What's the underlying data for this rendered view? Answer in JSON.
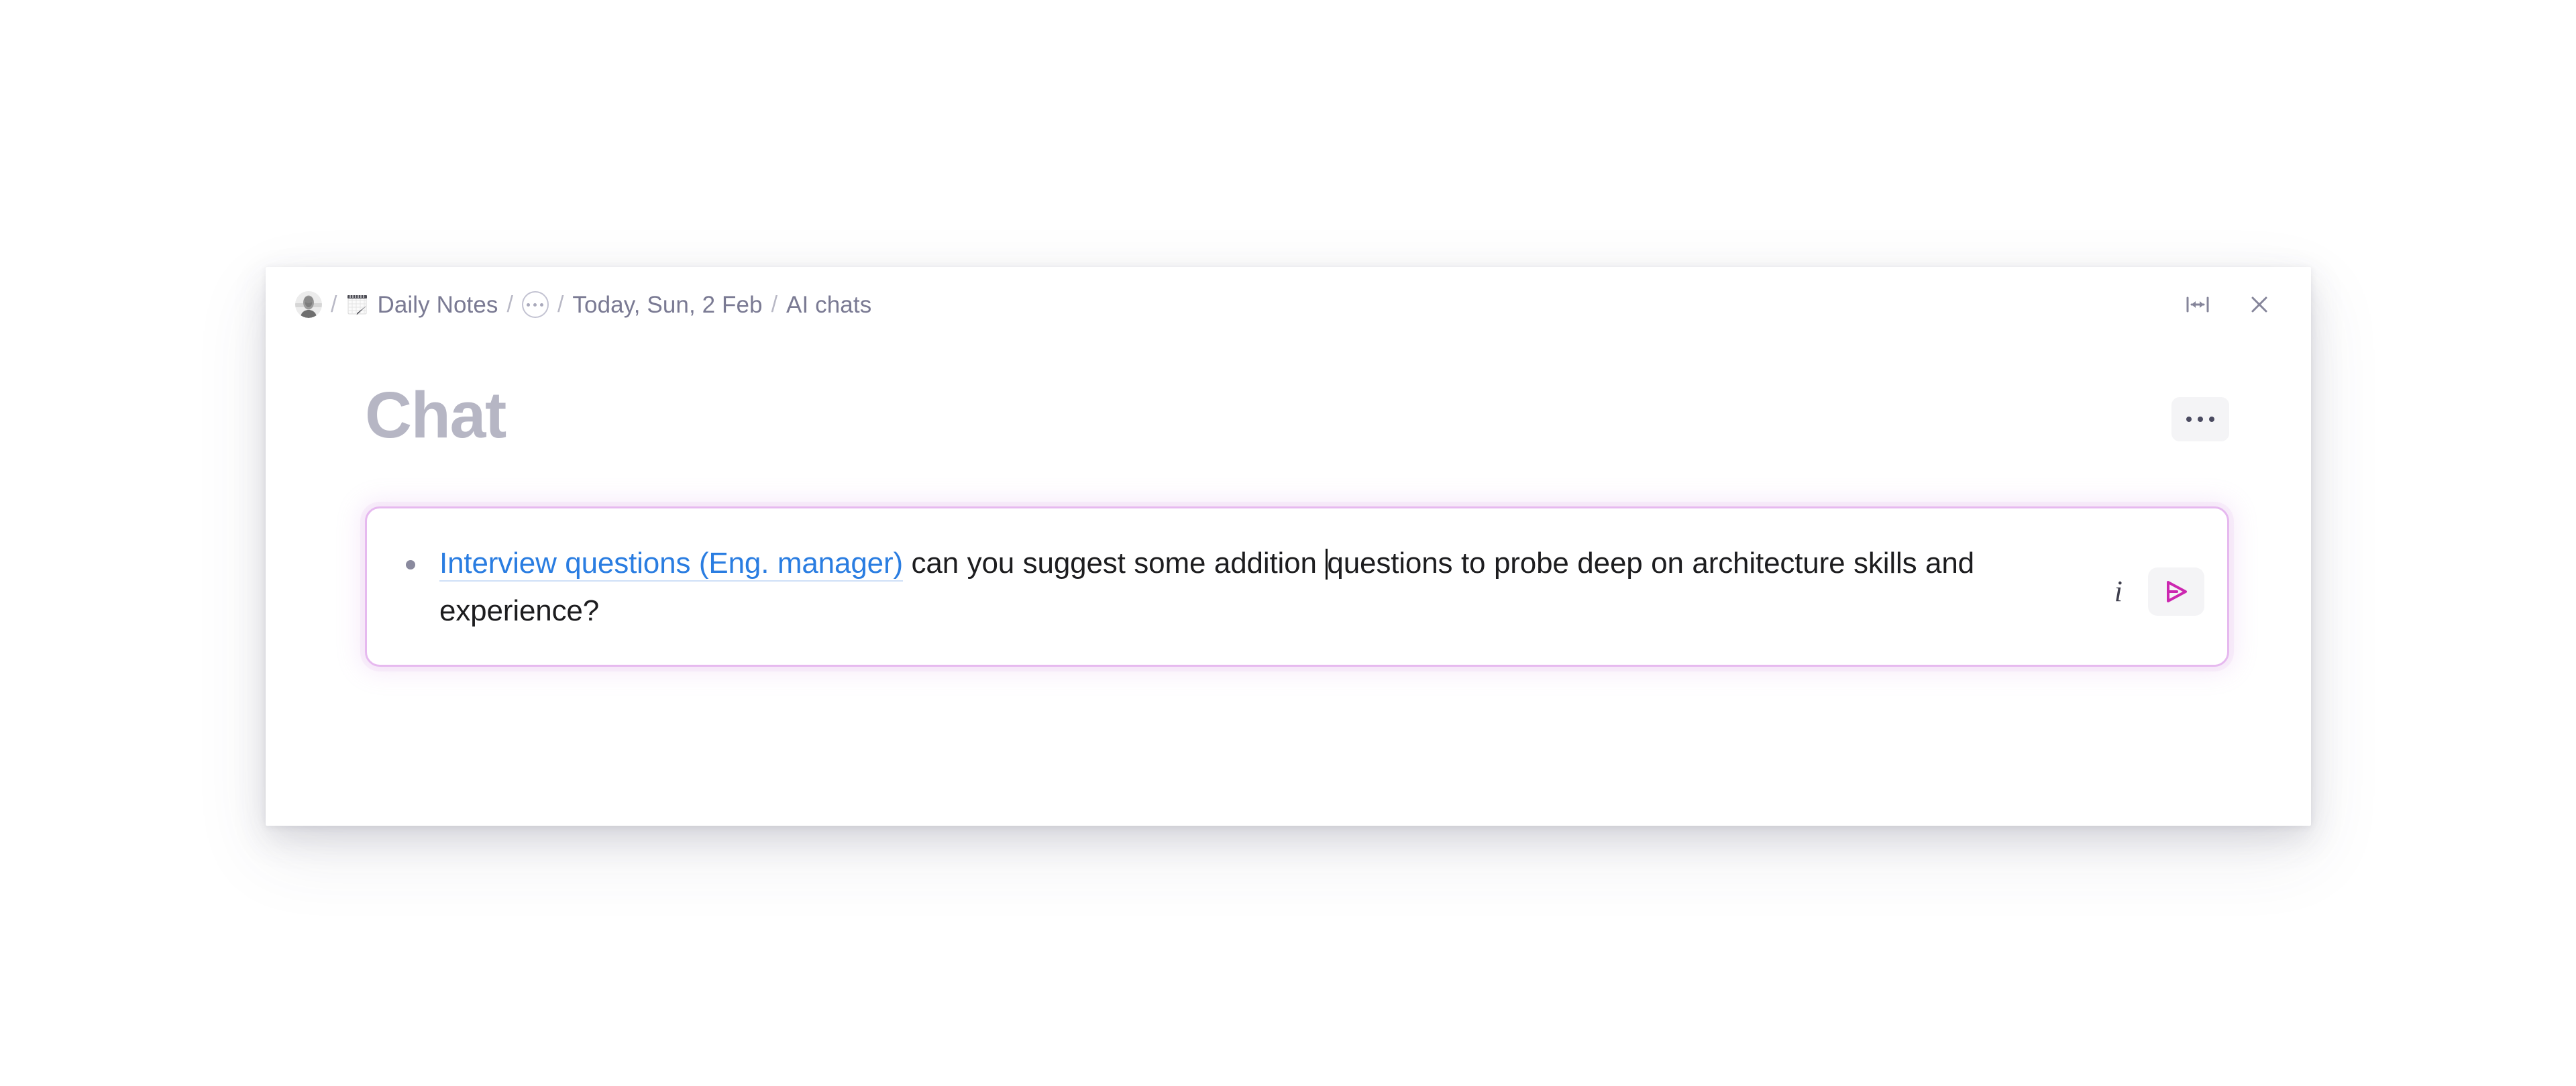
{
  "window": {
    "breadcrumb": [
      {
        "type": "avatar",
        "icon": "user-avatar-icon",
        "label": ""
      },
      {
        "type": "page",
        "icon": "notepad-emoji-icon",
        "label": "Daily Notes"
      },
      {
        "type": "collapsed",
        "icon": "ellipsis-circle-icon",
        "label": ""
      },
      {
        "type": "page",
        "icon": "",
        "label": "Today, Sun, 2 Feb"
      },
      {
        "type": "page",
        "icon": "",
        "label": "AI chats"
      }
    ],
    "separator": "/",
    "controls": [
      {
        "name": "resize-width-icon",
        "label": ""
      },
      {
        "name": "close-icon",
        "label": ""
      }
    ]
  },
  "document": {
    "title": "Chat",
    "more_label": "",
    "more_icon": "ellipsis-icon"
  },
  "composer": {
    "bullet": "•",
    "link_text": "Interview questions (Eng. manager)",
    "text_before_caret": " can you suggest some addition ",
    "text_after_caret": "questions to probe deep on architecture skills and experience?",
    "info_icon_label": "i",
    "send_icon": "send-paper-plane-icon"
  },
  "colors": {
    "page_background": "#ffffff",
    "window_background": "#ffffff",
    "breadcrumb_text": "#7a7a93",
    "breadcrumb_separator": "#b9b9c6",
    "title_text": "#b6b6c4",
    "body_text": "#1d1d1f",
    "link_text": "#2a7de1",
    "link_underline": "#cfe0f7",
    "composer_border": "#e6b9ef",
    "composer_glow": "#cd8ce1",
    "send_icon": "#cc27b0",
    "button_background": "#f4f4f6",
    "bullet": "#8a8a9e"
  }
}
